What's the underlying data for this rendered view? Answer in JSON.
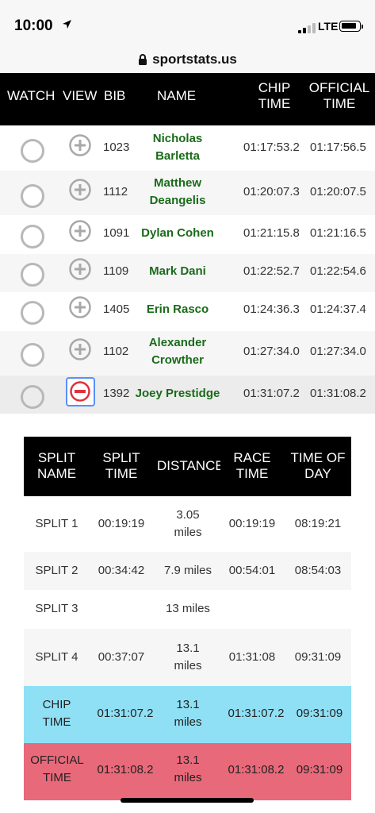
{
  "status_bar": {
    "time": "10:00",
    "network": "LTE"
  },
  "browser": {
    "url": "sportstats.us"
  },
  "results": {
    "headers": {
      "watch": "WATCH",
      "view": "VIEW",
      "bib": "BIB",
      "name": "NAME",
      "chip_time_line1": "CHIP",
      "chip_time_line2": "TIME",
      "official_time_line1": "OFFICIAL",
      "official_time_line2": "TIME"
    },
    "rows": [
      {
        "bib": "1023",
        "name_line1": "Nicholas",
        "name_line2": "Barletta",
        "chip_time": "01:17:53.2",
        "official_time": "01:17:56.5",
        "expanded": false
      },
      {
        "bib": "1112",
        "name_line1": "Matthew",
        "name_line2": "Deangelis",
        "chip_time": "01:20:07.3",
        "official_time": "01:20:07.5",
        "expanded": false
      },
      {
        "bib": "1091",
        "name_line1": "Dylan Cohen",
        "name_line2": "",
        "chip_time": "01:21:15.8",
        "official_time": "01:21:16.5",
        "expanded": false
      },
      {
        "bib": "1109",
        "name_line1": "Mark Dani",
        "name_line2": "",
        "chip_time": "01:22:52.7",
        "official_time": "01:22:54.6",
        "expanded": false
      },
      {
        "bib": "1405",
        "name_line1": "Erin Rasco",
        "name_line2": "",
        "chip_time": "01:24:36.3",
        "official_time": "01:24:37.4",
        "expanded": false
      },
      {
        "bib": "1102",
        "name_line1": "Alexander",
        "name_line2": "Crowther",
        "chip_time": "01:27:34.0",
        "official_time": "01:27:34.0",
        "expanded": false
      },
      {
        "bib": "1392",
        "name_line1": "Joey Prestidge",
        "name_line2": "",
        "chip_time": "01:31:07.2",
        "official_time": "01:31:08.2",
        "expanded": true
      }
    ]
  },
  "splits": {
    "headers": {
      "split_name_line1": "SPLIT",
      "split_name_line2": "NAME",
      "split_time_line1": "SPLIT",
      "split_time_line2": "TIME",
      "distance": "DISTANCE",
      "race_time_line1": "RACE",
      "race_time_line2": "TIME",
      "time_of_day_line1": "TIME OF",
      "time_of_day_line2": "DAY"
    },
    "rows": [
      {
        "name_line1": "SPLIT 1",
        "name_line2": "",
        "split_time": "00:19:19",
        "distance_line1": "3.05",
        "distance_line2": "miles",
        "race_time": "00:19:19",
        "time_of_day": "08:19:21"
      },
      {
        "name_line1": "SPLIT 2",
        "name_line2": "",
        "split_time": "00:34:42",
        "distance_line1": "7.9 miles",
        "distance_line2": "",
        "race_time": "00:54:01",
        "time_of_day": "08:54:03"
      },
      {
        "name_line1": "SPLIT 3",
        "name_line2": "",
        "split_time": "",
        "distance_line1": "13 miles",
        "distance_line2": "",
        "race_time": "",
        "time_of_day": ""
      },
      {
        "name_line1": "SPLIT 4",
        "name_line2": "",
        "split_time": "00:37:07",
        "distance_line1": "13.1",
        "distance_line2": "miles",
        "race_time": "01:31:08",
        "time_of_day": "09:31:09"
      },
      {
        "name_line1": "CHIP",
        "name_line2": "TIME",
        "split_time": "01:31:07.2",
        "distance_line1": "13.1",
        "distance_line2": "miles",
        "race_time": "01:31:07.2",
        "time_of_day": "09:31:09"
      },
      {
        "name_line1": "OFFICIAL",
        "name_line2": "TIME",
        "split_time": "01:31:08.2",
        "distance_line1": "13.1",
        "distance_line2": "miles",
        "race_time": "01:31:08.2",
        "time_of_day": "09:31:09"
      }
    ]
  },
  "colors": {
    "name_green": "#1a6b1a",
    "chip_row": "#8fe0f5",
    "official_row": "#e8697a",
    "header_bg": "#000000",
    "selected_outline": "#5b8ff9",
    "minus_red": "#e0313f"
  },
  "icons": {
    "status_arrow": "location-arrow-icon",
    "lock": "lock-icon",
    "view_expand": "plus-circle-icon",
    "view_collapse": "minus-circle-icon",
    "watch": "radio-circle-icon"
  }
}
